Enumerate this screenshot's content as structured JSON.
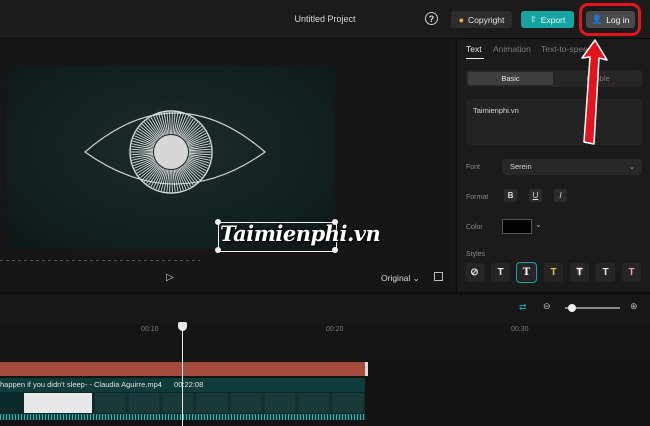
{
  "header": {
    "title": "Untitled Project",
    "help_icon": "question-circle-icon",
    "help_glyph": "?",
    "copyright_label": "Copyright",
    "export_label": "Export",
    "login_label": "Log in"
  },
  "colors": {
    "accent": "#16a3a1",
    "annotation_red": "#e4141c",
    "audio_clip": "#a44b3e"
  },
  "player": {
    "ratio_label": "Original",
    "ratio_chevron": "⌄",
    "overlay_text": "Taimienphi.vn",
    "play_icon": "play-icon"
  },
  "panel": {
    "tabs": [
      "Text",
      "Animation",
      "Text-to-speech"
    ],
    "segments": [
      "Basic",
      "Bubble"
    ],
    "text_value": "Taimienphi.vn",
    "font_label": "Font",
    "font_value": "Serein",
    "format_label": "Format",
    "format_buttons": [
      "B",
      "U",
      "I"
    ],
    "color_label": "Color",
    "styles_label": "Styles",
    "style_glyphs": [
      "⊘",
      "T",
      "T",
      "T",
      "T",
      "T",
      "T"
    ]
  },
  "timeline": {
    "ticks": [
      "00:10",
      "00:20",
      "00:30"
    ],
    "clip_name": "happen if you didn't sleep- - Claudia Aguirre.mp4",
    "clip_duration": "00:22:08"
  }
}
